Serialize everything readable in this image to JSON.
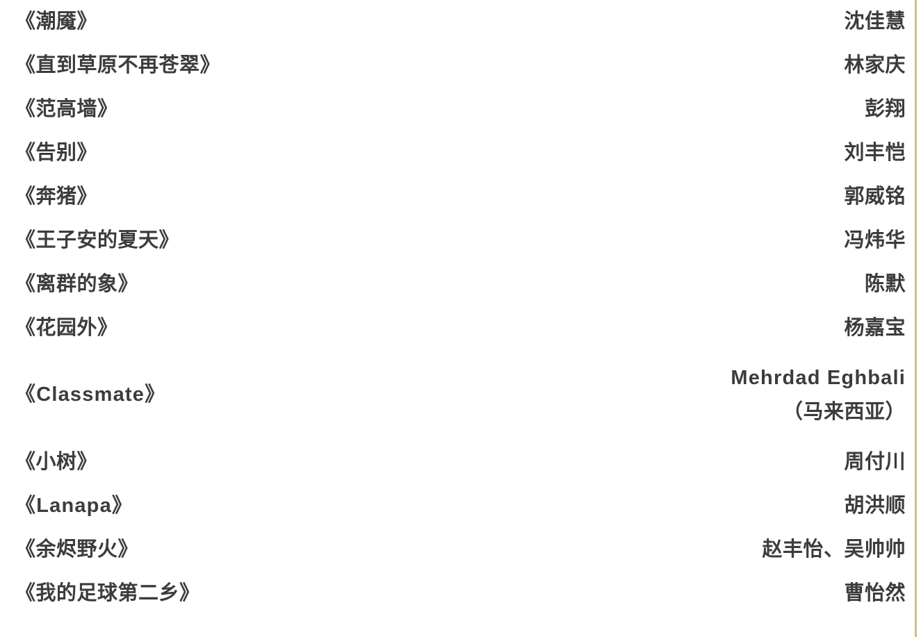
{
  "page": {
    "background_color": "#ffffff",
    "text_color": "#3c3c3c",
    "accent_rule_color": "#cbc08c"
  },
  "entries": [
    {
      "title": "《潮魇》",
      "creator": "沈佳慧",
      "creator_note": ""
    },
    {
      "title": "《直到草原不再苍翠》",
      "creator": "林家庆",
      "creator_note": ""
    },
    {
      "title": "《范高墙》",
      "creator": "彭翔",
      "creator_note": ""
    },
    {
      "title": "《告别》",
      "creator": "刘丰恺",
      "creator_note": ""
    },
    {
      "title": "《奔猪》",
      "creator": "郭威铭",
      "creator_note": ""
    },
    {
      "title": "《王子安的夏天》",
      "creator": "冯炜华",
      "creator_note": ""
    },
    {
      "title": "《离群的象》",
      "creator": "陈默",
      "creator_note": ""
    },
    {
      "title": "《花园外》",
      "creator": "杨嘉宝",
      "creator_note": ""
    },
    {
      "title": "《Classmate》",
      "creator": "Mehrdad Eghbali",
      "creator_note": "（马来西亚）"
    },
    {
      "title": "《小树》",
      "creator": "周付川",
      "creator_note": ""
    },
    {
      "title": "《Lanapa》",
      "creator": "胡洪顺",
      "creator_note": ""
    },
    {
      "title": "《余烬野火》",
      "creator": "赵丰怡、吴帅帅",
      "creator_note": ""
    },
    {
      "title": "《我的足球第二乡》",
      "creator": "曹怡然",
      "creator_note": ""
    }
  ]
}
